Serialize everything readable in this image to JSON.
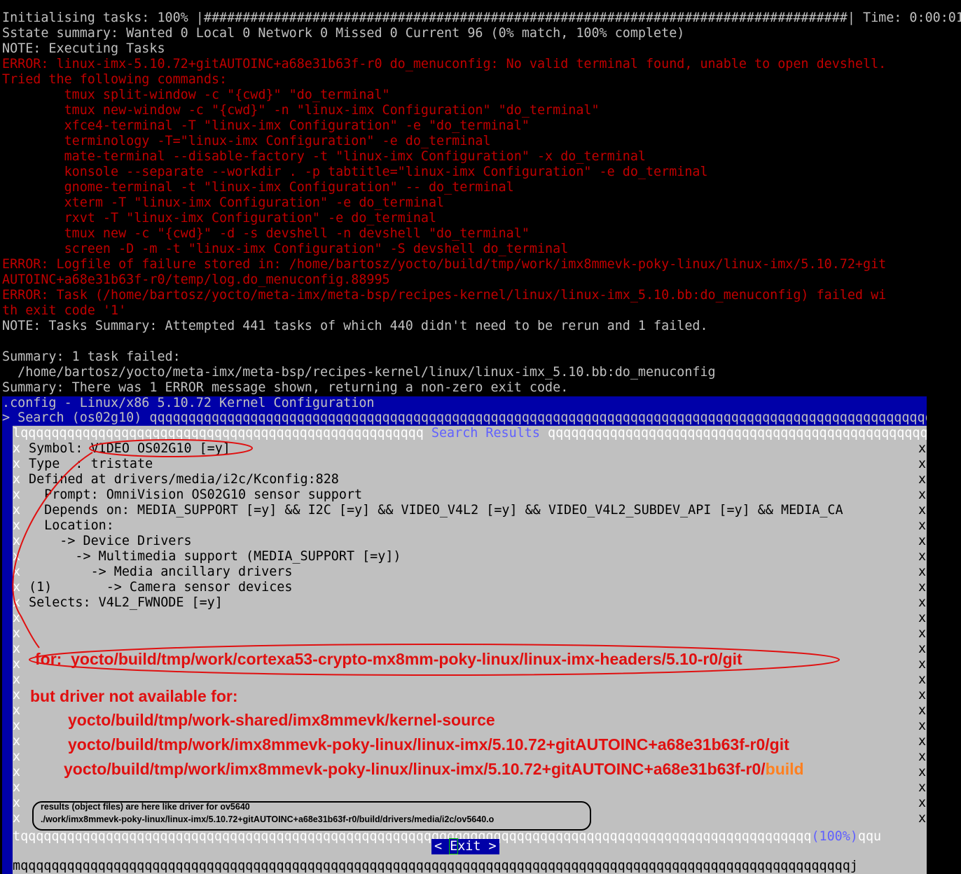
{
  "terminal": {
    "lines": [
      {
        "text": "Initialising tasks: 100% |###################################################################################| Time: 0:00:01",
        "color": "gray"
      },
      {
        "text": "Sstate summary: Wanted 0 Local 0 Network 0 Missed 0 Current 96 (0% match, 100% complete)",
        "color": "gray"
      },
      {
        "text": "NOTE: Executing Tasks",
        "color": "gray"
      },
      {
        "text": "ERROR: linux-imx-5.10.72+gitAUTOINC+a68e31b63f-r0 do_menuconfig: No valid terminal found, unable to open devshell.",
        "color": "red"
      },
      {
        "text": "Tried the following commands:",
        "color": "red"
      },
      {
        "text": "        tmux split-window -c \"{cwd}\" \"do_terminal\"",
        "color": "red"
      },
      {
        "text": "        tmux new-window -c \"{cwd}\" -n \"linux-imx Configuration\" \"do_terminal\"",
        "color": "red"
      },
      {
        "text": "        xfce4-terminal -T \"linux-imx Configuration\" -e \"do_terminal\"",
        "color": "red"
      },
      {
        "text": "        terminology -T=\"linux-imx Configuration\" -e do_terminal",
        "color": "red"
      },
      {
        "text": "        mate-terminal --disable-factory -t \"linux-imx Configuration\" -x do_terminal",
        "color": "red"
      },
      {
        "text": "        konsole --separate --workdir . -p tabtitle=\"linux-imx Configuration\" -e do_terminal",
        "color": "red"
      },
      {
        "text": "        gnome-terminal -t \"linux-imx Configuration\" -- do_terminal",
        "color": "red"
      },
      {
        "text": "        xterm -T \"linux-imx Configuration\" -e do_terminal",
        "color": "red"
      },
      {
        "text": "        rxvt -T \"linux-imx Configuration\" -e do_terminal",
        "color": "red"
      },
      {
        "text": "        tmux new -c \"{cwd}\" -d -s devshell -n devshell \"do_terminal\"",
        "color": "red"
      },
      {
        "text": "        screen -D -m -t \"linux-imx Configuration\" -S devshell do_terminal",
        "color": "red"
      },
      {
        "text": "ERROR: Logfile of failure stored in: /home/bartosz/yocto/build/tmp/work/imx8mmevk-poky-linux/linux-imx/5.10.72+git",
        "color": "red"
      },
      {
        "text": "AUTOINC+a68e31b63f-r0/temp/log.do_menuconfig.88995",
        "color": "red"
      },
      {
        "text": "ERROR: Task (/home/bartosz/yocto/meta-imx/meta-bsp/recipes-kernel/linux/linux-imx_5.10.bb:do_menuconfig) failed wi",
        "color": "red"
      },
      {
        "text": "th exit code '1'",
        "color": "red"
      },
      {
        "text": "NOTE: Tasks Summary: Attempted 441 tasks of which 440 didn't need to be rerun and 1 failed.",
        "color": "gray"
      },
      {
        "text": "",
        "color": "gray"
      },
      {
        "text": "Summary: 1 task failed:",
        "color": "gray"
      },
      {
        "text": "  /home/bartosz/yocto/meta-imx/meta-bsp/recipes-kernel/linux/linux-imx_5.10.bb:do_menuconfig",
        "color": "gray"
      },
      {
        "text": "Summary: There was 1 ERROR message shown, returning a non-zero exit code.",
        "color": "gray"
      }
    ]
  },
  "menuconfig": {
    "title": ".config - Linux/x86 5.10.72 Kernel Configuration",
    "search_line": "> Search (os02g10) qqqqqqqqqqqqqqqqqqqqqqqqqqqqqqqqqqqqqqqqqqqqqqqqqqqqqqqqqqqqqqqqqqqqqqqqqqqqqqqqqqqqqqqqqqqqqqqqqqqqqq",
    "dialog_top_left": "lqqqqqqqqqqqqqqqqqqqqqqqqqqqqqqqqqqqqqqqqqqqqqqqqqqqq ",
    "dialog_title": "Search Results",
    "dialog_top_right": " qqqqqqqqqqqqqqqqqqqqqqqqqqqqqqqqqqqqqqqqqqqqqqqqqqqqqqqqqqqqqk",
    "results": [
      "Symbol: VIDEO_OS02G10 [=y]",
      "Type  : tristate",
      "Defined at drivers/media/i2c/Kconfig:828",
      "  Prompt: OmniVision OS02G10 sensor support",
      "  Depends on: MEDIA_SUPPORT [=y] && I2C [=y] && VIDEO_V4L2 [=y] && VIDEO_V4L2_SUBDEV_API [=y] && MEDIA_CA",
      "  Location:",
      "    -> Device Drivers",
      "      -> Multimedia support (MEDIA_SUPPORT [=y])",
      "        -> Media ancillary drivers",
      "(1)       -> Camera sensor devices",
      "Selects: V4L2_FWNODE [=y]"
    ],
    "border_char_left": "x",
    "border_char_right": "x",
    "separator_left": "tqqqqqqqqqqqqqqqqqqqqqqqqqqqqqqqqqqqqqqqqqqqqqqqqqqqqqqqqqqqqqqqqqqqqqqqqqqqqqqqqqqqqqqqqqqqqqqqqqqqqqq",
    "scroll_percent": "(100%)",
    "separator_right": "qqu",
    "bottom_line": "mqqqqqqqqqqqqqqqqqqqqqqqqqqqqqqqqqqqqqqqqqqqqqqqqqqqqqqqqqqqqqqqqqqqqqqqqqqqqqqqqqqqqqqqqqqqqqqqqqqqqqqqqqqqj",
    "exit_left": "< ",
    "exit_hotkey": "E",
    "exit_rest": "xit >"
  },
  "annotations": {
    "for_line": "for:  yocto/build/tmp/work/cortexa53-crypto-mx8mm-poky-linux/linux-imx-headers/5.10-r0/git",
    "but_line": "but driver not available for:",
    "path1": "yocto/build/tmp/work-shared/imx8mmevk/kernel-source",
    "path2": "yocto/build/tmp/work/imx8mmevk-poky-linux/linux-imx/5.10.72+gitAUTOINC+a68e31b63f-r0/git",
    "path3_main": "yocto/build/tmp/work/imx8mmevk-poky-linux/linux-imx/5.10.72+gitAUTOINC+a68e31b63f-r0/",
    "path3_suffix": "build",
    "note_line1": "results (object files) are here like driver for ov5640",
    "note_line2": "./work/imx8mmevk-poky-linux/linux-imx/5.10.72+gitAUTOINC+a68e31b63f-r0/build/drivers/media/i2c/ov5640.o"
  },
  "colors": {
    "term_bg": "#000000",
    "term_gray": "#c0c0c0",
    "term_red": "#c00000",
    "menuconfig_blue": "#0000a8",
    "dialog_gray": "#c0c0c0",
    "annotation_red": "#e01010",
    "annotation_orange": "#ff8020"
  }
}
